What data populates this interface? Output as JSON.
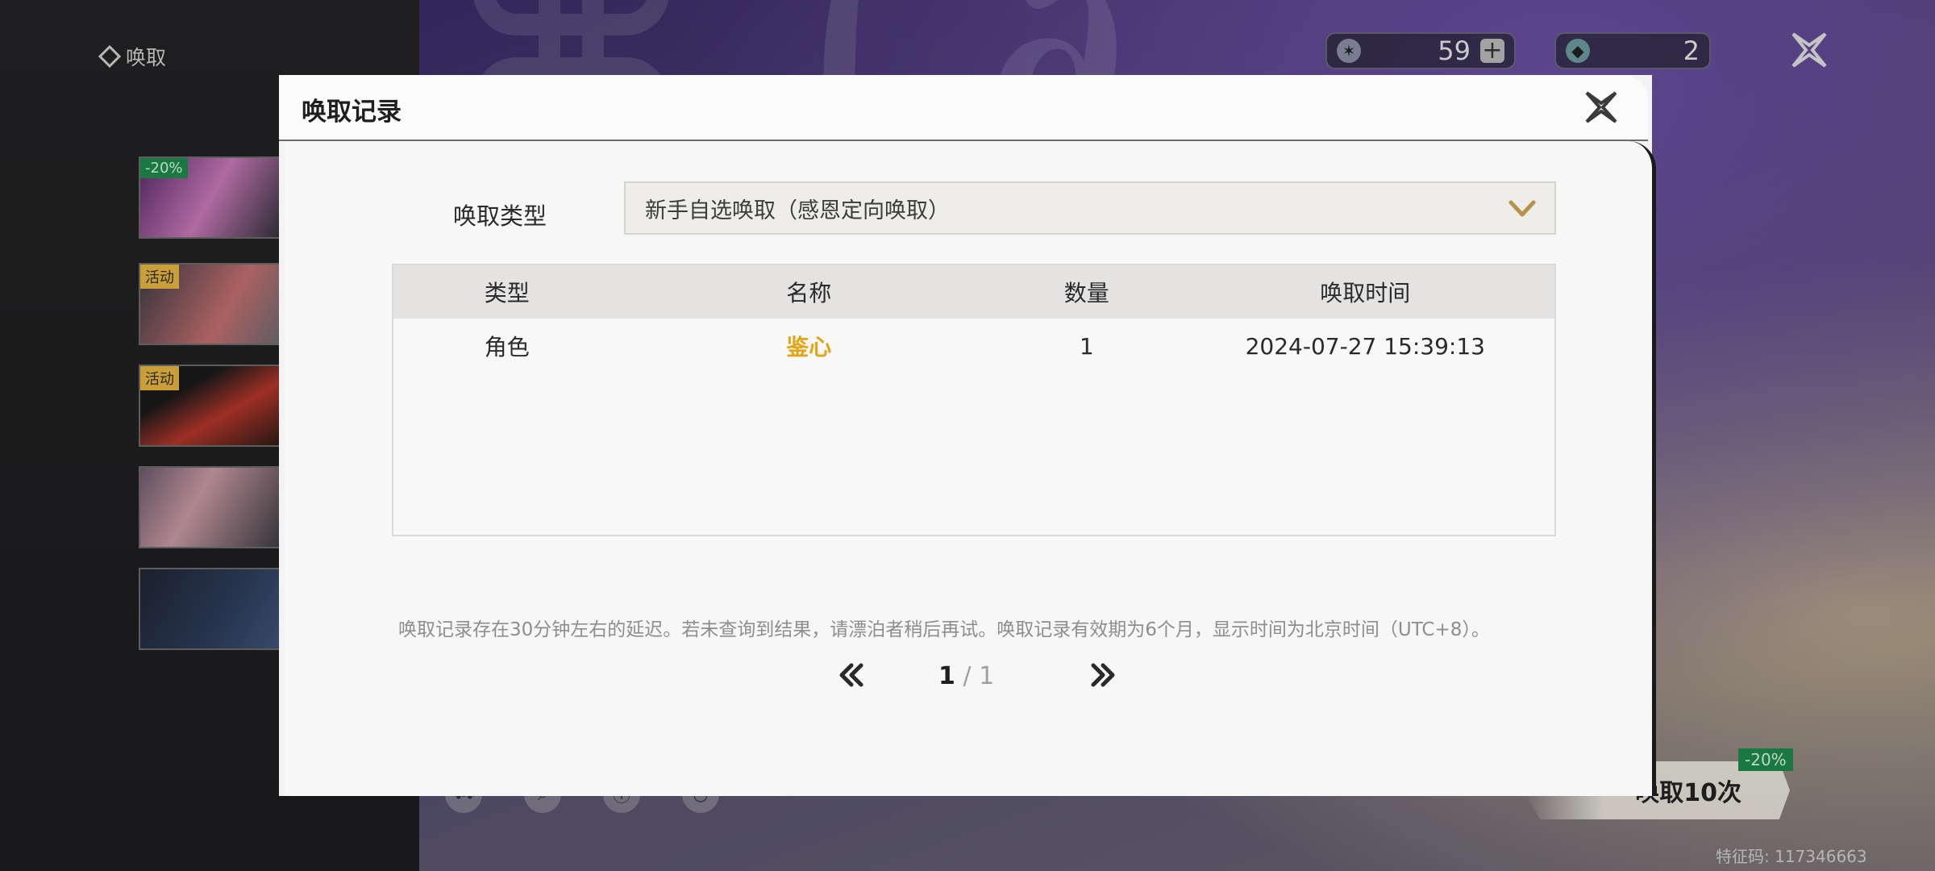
{
  "background": {
    "brand_label": "唤取",
    "banners": [
      {
        "tag": "-20%",
        "tag_kind": "discount"
      },
      {
        "tag": "活动",
        "tag_kind": "event"
      },
      {
        "tag": "活动",
        "tag_kind": "event"
      },
      {
        "tag": "",
        "tag_kind": "none"
      },
      {
        "tag": "",
        "tag_kind": "none"
      }
    ],
    "currency_a": {
      "icon": "star-icon",
      "value": "59"
    },
    "currency_b": {
      "icon": "gem-icon",
      "value": "2"
    },
    "pull10_label": "唤取10次",
    "pull10_discount": "-20%",
    "feature_code": "特征码: 117346663"
  },
  "modal": {
    "title": "唤取记录",
    "type_label": "唤取类型",
    "type_value": "新手自选唤取（感恩定向唤取）",
    "columns": [
      "类型",
      "名称",
      "数量",
      "唤取时间"
    ],
    "rows": [
      {
        "type": "角色",
        "name": "鉴心",
        "count": "1",
        "time": "2024-07-27 15:39:13"
      }
    ],
    "note": "唤取记录存在30分钟左右的延迟。若未查询到结果，请漂泊者稍后再试。唤取记录有效期为6个月，显示时间为北京时间（UTC+8）。",
    "pagination": {
      "current": "1",
      "separator": "/",
      "total": "1"
    }
  },
  "colors": {
    "accent_gold": "#e2a516",
    "discount_green": "#1e8a4c",
    "event_yellow": "#e8b640"
  }
}
